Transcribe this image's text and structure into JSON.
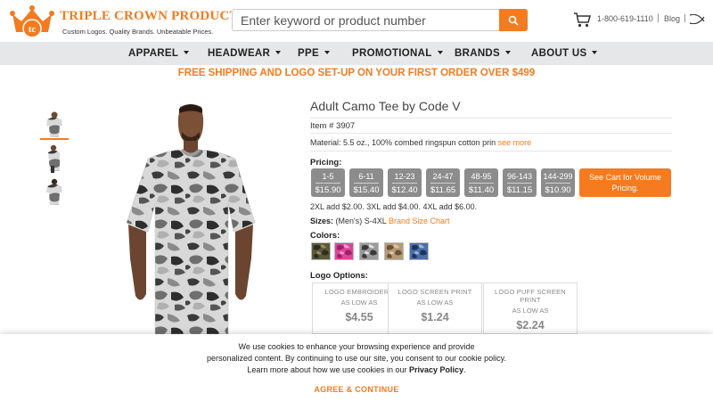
{
  "header": {
    "brand_title": "TRIPLE CROWN PRODUCTS",
    "brand_tagline": "Custom Logos. Quality Brands. Unbeatable Prices.",
    "logo_letters": "tc",
    "search_placeholder": "Enter keyword or product number",
    "phone": "1-800-619-1110",
    "separator": "|",
    "blog_label": "Blog",
    "accent_color": "#f47b20",
    "icons": [
      "crown-logo-icon",
      "search-icon",
      "cart-icon",
      "ichthys-fish-icon"
    ]
  },
  "nav": {
    "items": [
      {
        "label": "APPAREL"
      },
      {
        "label": "HEADWEAR"
      },
      {
        "label": "PPE"
      },
      {
        "label": "PROMOTIONAL"
      },
      {
        "label": "BRANDS"
      },
      {
        "label": "ABOUT US"
      }
    ]
  },
  "promo": "FREE SHIPPING AND LOGO SET-UP ON YOUR FIRST ORDER OVER $499",
  "product": {
    "title": "Adult Camo Tee by Code V",
    "item_number": "Item # 3907",
    "material": "Material: 5.5 oz., 100% combed ringspun cotton prin",
    "see_more": "see more",
    "pricing_label": "Pricing:",
    "price_tiers": [
      {
        "qty": "1-5",
        "price": "$15.90"
      },
      {
        "qty": "6-11",
        "price": "$15.40"
      },
      {
        "qty": "12-23",
        "price": "$12.40"
      },
      {
        "qty": "24-47",
        "price": "$11.65"
      },
      {
        "qty": "48-95",
        "price": "$11.40"
      },
      {
        "qty": "96-143",
        "price": "$11.15"
      },
      {
        "qty": "144-299",
        "price": "$10.90"
      }
    ],
    "volume_button": "See Cart for Volume Pricing.",
    "upcharge": "2XL add $2.00. 3XL add $4.00. 4XL add $6.00.",
    "sizes_label": "Sizes:",
    "sizes_value": "(Men's) S-4XL",
    "size_chart_link": "Brand Size Chart",
    "colors_label": "Colors:",
    "colors": [
      {
        "name": "green-camo-swatch",
        "base": "#5b5a3a"
      },
      {
        "name": "pink-camo-swatch",
        "base": "#e0459a"
      },
      {
        "name": "urban-camo-swatch",
        "base": "#9a9a9a"
      },
      {
        "name": "desert-camo-swatch",
        "base": "#b59a78"
      },
      {
        "name": "blue-camo-swatch",
        "base": "#4c6fa8"
      }
    ],
    "logo_options_label": "Logo Options:",
    "logo_options": [
      {
        "name": "LOGO EMBROIDERY",
        "as_low_as": "AS LOW AS",
        "price": "$4.55"
      },
      {
        "name": "LOGO SCREEN PRINT",
        "as_low_as": "AS LOW AS",
        "price": "$1.24"
      },
      {
        "name": "LOGO PUFF SCREEN PRINT",
        "as_low_as": "AS LOW AS",
        "price": "$2.24"
      }
    ]
  },
  "cookie": {
    "line1": "We use cookies to enhance your browsing experience and provide",
    "line2": "personalized content. By continuing to use our site, you consent to our cookie policy.",
    "line3_prefix": "Learn more about how we use cookies in our",
    "policy_link": "Privacy Policy",
    "line3_suffix": ".",
    "agree": "AGREE & CONTINUE"
  }
}
